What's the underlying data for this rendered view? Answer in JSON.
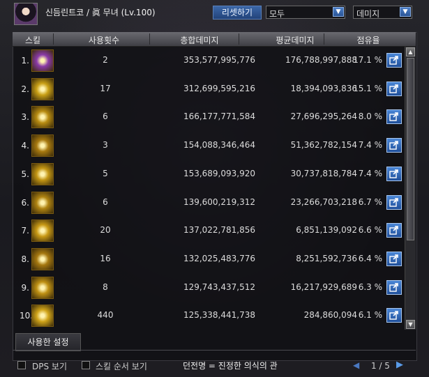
{
  "header": {
    "character_name": "신듬린트코 / 眞 무녀 (Lv.100)",
    "reset_label": "리셋하기",
    "filter_value": "모두",
    "metric_value": "데미지"
  },
  "table": {
    "headers": [
      "스킬",
      "사용횟수",
      "총합데미지",
      "평균데미지",
      "점유율"
    ],
    "rows": [
      {
        "rank": "1.",
        "count": "2",
        "total": "353,577,995,776",
        "avg": "176,788,997,888",
        "share": "17.1 %",
        "icon": "purple-burst-icon",
        "color": "#8a3aa8"
      },
      {
        "rank": "2.",
        "count": "17",
        "total": "312,699,595,216",
        "avg": "18,394,093,836",
        "share": "15.1 %",
        "icon": "golden-sun-icon",
        "color": "#c9a017"
      },
      {
        "rank": "3.",
        "count": "6",
        "total": "166,177,771,584",
        "avg": "27,696,295,264",
        "share": "8.0 %",
        "icon": "golden-chain-icon",
        "color": "#b88c12"
      },
      {
        "rank": "4.",
        "count": "3",
        "total": "154,088,346,464",
        "avg": "51,362,782,154",
        "share": "7.4 %",
        "icon": "golden-shield-icon",
        "color": "#a87a10"
      },
      {
        "rank": "5.",
        "count": "5",
        "total": "153,689,093,920",
        "avg": "30,737,818,784",
        "share": "7.4 %",
        "icon": "golden-claw-icon",
        "color": "#c39614"
      },
      {
        "rank": "6.",
        "count": "6",
        "total": "139,600,219,312",
        "avg": "23,266,703,218",
        "share": "6.7 %",
        "icon": "golden-arrows-icon",
        "color": "#b08412"
      },
      {
        "rank": "7.",
        "count": "20",
        "total": "137,022,781,856",
        "avg": "6,851,139,092",
        "share": "6.6 %",
        "icon": "golden-spiral-icon",
        "color": "#c99a16"
      },
      {
        "rank": "8.",
        "count": "16",
        "total": "132,025,483,776",
        "avg": "8,251,592,736",
        "share": "6.4 %",
        "icon": "golden-dragon-icon",
        "color": "#a67810"
      },
      {
        "rank": "9.",
        "count": "8",
        "total": "129,743,437,512",
        "avg": "16,217,929,689",
        "share": "6.3 %",
        "icon": "golden-vortex-icon",
        "color": "#bf9114"
      },
      {
        "rank": "10.",
        "count": "440",
        "total": "125,338,441,738",
        "avg": "284,860,094",
        "share": "6.1 %",
        "icon": "golden-streak-icon",
        "color": "#d0a41a"
      }
    ]
  },
  "bottom": {
    "settings_tab": "사용한 설정",
    "dps_label": "DPS 보기",
    "skill_order_label": "스킬 순서 보기",
    "dungeon_text": "던전명 = 진정한 의식의 관",
    "page_indicator": "1 / 5"
  },
  "colors": {
    "accent": "#2f5da3",
    "header_bar": "#5a5a60"
  }
}
